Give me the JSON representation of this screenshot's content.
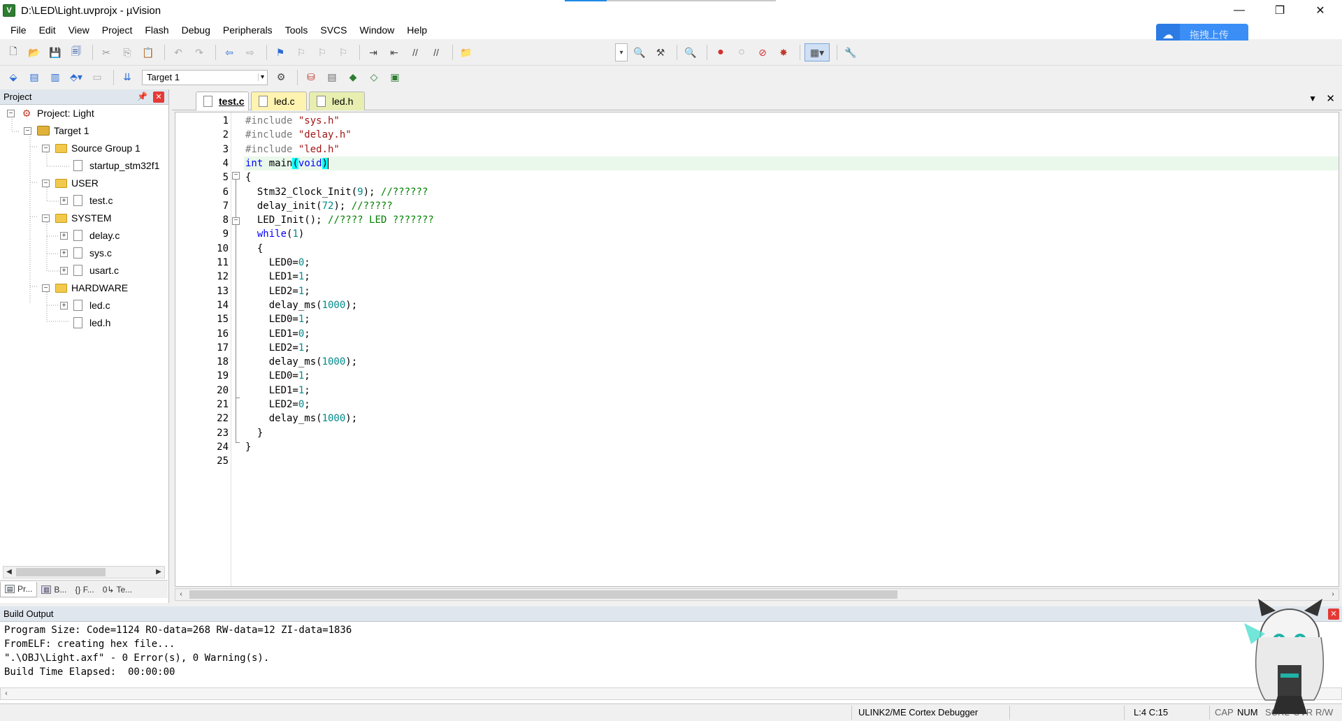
{
  "window": {
    "title": "D:\\LED\\Light.uvprojx - µVision",
    "app_icon_glyph": "V",
    "minimize_glyph": "—",
    "restore_glyph": "❐",
    "close_glyph": "✕"
  },
  "menu": [
    "File",
    "Edit",
    "View",
    "Project",
    "Flash",
    "Debug",
    "Peripherals",
    "Tools",
    "SVCS",
    "Window",
    "Help"
  ],
  "cloud_upload": {
    "label": "拖拽上传",
    "icon": "cloud-icon"
  },
  "toolbar2": {
    "target": "Target 1"
  },
  "project_panel": {
    "title": "Project",
    "tree": [
      {
        "label": "Project: Light",
        "level": 0,
        "kind": "project",
        "expander": "⊟"
      },
      {
        "label": "Target 1",
        "level": 1,
        "kind": "target",
        "expander": "⊟"
      },
      {
        "label": "Source Group 1",
        "level": 2,
        "kind": "folder",
        "expander": "⊟"
      },
      {
        "label": "startup_stm32f1",
        "level": 3,
        "kind": "file",
        "expander": ""
      },
      {
        "label": "USER",
        "level": 2,
        "kind": "folder",
        "expander": "⊟"
      },
      {
        "label": "test.c",
        "level": 3,
        "kind": "file",
        "expander": "⊞"
      },
      {
        "label": "SYSTEM",
        "level": 2,
        "kind": "folder",
        "expander": "⊟"
      },
      {
        "label": "delay.c",
        "level": 3,
        "kind": "file",
        "expander": "⊞"
      },
      {
        "label": "sys.c",
        "level": 3,
        "kind": "file",
        "expander": "⊞"
      },
      {
        "label": "usart.c",
        "level": 3,
        "kind": "file",
        "expander": "⊞"
      },
      {
        "label": "HARDWARE",
        "level": 2,
        "kind": "folder",
        "expander": "⊟"
      },
      {
        "label": "led.c",
        "level": 3,
        "kind": "file",
        "expander": "⊞"
      },
      {
        "label": "led.h",
        "level": 3,
        "kind": "file",
        "expander": ""
      }
    ],
    "bottom_tabs": [
      {
        "label": "Pr...",
        "icon": "project-tab-icon"
      },
      {
        "label": "B...",
        "icon": "books-tab-icon"
      },
      {
        "label": "{} F...",
        "icon": "functions-tab-icon"
      },
      {
        "label": "Te...",
        "icon": "templates-tab-icon"
      }
    ]
  },
  "editor": {
    "tabs": [
      {
        "label": "test.c",
        "active": true,
        "style": "active"
      },
      {
        "label": "led.c",
        "active": false,
        "style": "yellow"
      },
      {
        "label": "led.h",
        "active": false,
        "style": "green"
      }
    ],
    "current_line": 4,
    "lines": [
      [
        [
          "pp",
          "#include "
        ],
        [
          "str",
          "\"sys.h\""
        ]
      ],
      [
        [
          "pp",
          "#include "
        ],
        [
          "str",
          "\"delay.h\""
        ]
      ],
      [
        [
          "pp",
          "#include "
        ],
        [
          "str",
          "\"led.h\""
        ]
      ],
      [
        [
          "kw",
          "int"
        ],
        [
          "",
          " main"
        ],
        [
          "brace",
          "("
        ],
        [
          "kw",
          "void"
        ],
        [
          "brace",
          ")"
        ],
        [
          "caret",
          ""
        ]
      ],
      [
        [
          "",
          "{"
        ]
      ],
      [
        [
          "",
          "  Stm32_Clock_Init("
        ],
        [
          "num",
          "9"
        ],
        [
          "",
          "); "
        ],
        [
          "cm",
          "//??????"
        ]
      ],
      [
        [
          "",
          "  delay_init("
        ],
        [
          "num",
          "72"
        ],
        [
          "",
          "); "
        ],
        [
          "cm",
          "//?????"
        ]
      ],
      [
        [
          "",
          "  LED_Init(); "
        ],
        [
          "cm",
          "//???? LED ???????"
        ]
      ],
      [
        [
          "",
          "  "
        ],
        [
          "kw",
          "while"
        ],
        [
          "",
          "("
        ],
        [
          "num",
          "1"
        ],
        [
          "",
          ")"
        ]
      ],
      [
        [
          "",
          "  {"
        ]
      ],
      [
        [
          "",
          "    LED0="
        ],
        [
          "num",
          "0"
        ],
        [
          "",
          ";"
        ]
      ],
      [
        [
          "",
          "    LED1="
        ],
        [
          "num",
          "1"
        ],
        [
          "",
          ";"
        ]
      ],
      [
        [
          "",
          "    LED2="
        ],
        [
          "num",
          "1"
        ],
        [
          "",
          ";"
        ]
      ],
      [
        [
          "",
          "    delay_ms("
        ],
        [
          "num",
          "1000"
        ],
        [
          "",
          ");"
        ]
      ],
      [
        [
          "",
          "    LED0="
        ],
        [
          "num",
          "1"
        ],
        [
          "",
          ";"
        ]
      ],
      [
        [
          "",
          "    LED1="
        ],
        [
          "num",
          "0"
        ],
        [
          "",
          ";"
        ]
      ],
      [
        [
          "",
          "    LED2="
        ],
        [
          "num",
          "1"
        ],
        [
          "",
          ";"
        ]
      ],
      [
        [
          "",
          "    delay_ms("
        ],
        [
          "num",
          "1000"
        ],
        [
          "",
          ");"
        ]
      ],
      [
        [
          "",
          "    LED0="
        ],
        [
          "num",
          "1"
        ],
        [
          "",
          ";"
        ]
      ],
      [
        [
          "",
          "    LED1="
        ],
        [
          "num",
          "1"
        ],
        [
          "",
          ";"
        ]
      ],
      [
        [
          "",
          "    LED2="
        ],
        [
          "num",
          "0"
        ],
        [
          "",
          ";"
        ]
      ],
      [
        [
          "",
          "    delay_ms("
        ],
        [
          "num",
          "1000"
        ],
        [
          "",
          ");"
        ]
      ],
      [
        [
          "",
          "  }"
        ]
      ],
      [
        [
          "",
          "}"
        ]
      ],
      [
        [
          "",
          ""
        ]
      ]
    ]
  },
  "build_output": {
    "title": "Build Output",
    "lines": [
      "Program Size: Code=1124 RO-data=268 RW-data=12 ZI-data=1836",
      "FromELF: creating hex file...",
      "\".\\OBJ\\Light.axf\" - 0 Error(s), 0 Warning(s).",
      "Build Time Elapsed:  00:00:00"
    ]
  },
  "status_bar": {
    "debugger": "ULINK2/ME Cortex Debugger",
    "position": "L:4 C:15",
    "caps": "CAP",
    "num": "NUM",
    "scroll": "SCRL",
    "ovr": "OVR",
    "rw": "R/W"
  }
}
